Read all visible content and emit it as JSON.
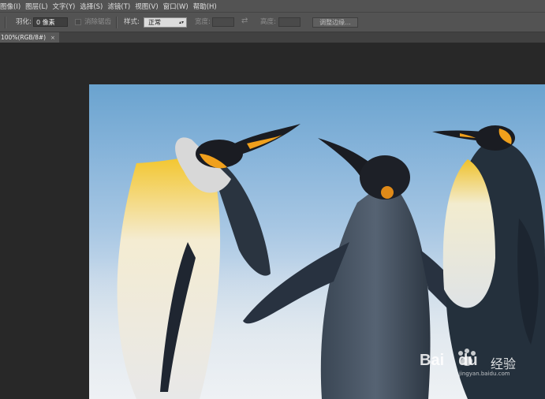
{
  "menu": {
    "items": [
      {
        "label": "图像(I)"
      },
      {
        "label": "图层(L)"
      },
      {
        "label": "文字(Y)"
      },
      {
        "label": "选择(S)"
      },
      {
        "label": "滤镜(T)"
      },
      {
        "label": "视图(V)"
      },
      {
        "label": "窗口(W)"
      },
      {
        "label": "帮助(H)"
      }
    ]
  },
  "options": {
    "feather_label": "羽化:",
    "feather_value": "0 像素",
    "antialias_label": "消除锯齿",
    "style_label": "样式:",
    "style_value": "正常",
    "width_label": "宽度:",
    "height_label": "高度:",
    "refine_button": "调整边缘..."
  },
  "document": {
    "tab_label": "100%(RGB/8#)",
    "close": "×"
  },
  "watermark": {
    "brand": "Bai",
    "brand_tail": "du",
    "suffix": "经验",
    "url": "jingyan.baidu.com"
  },
  "colors": {
    "panel": "#535353",
    "canvas_bg": "#282828",
    "accent_penguin_orange": "#f0a01c"
  }
}
